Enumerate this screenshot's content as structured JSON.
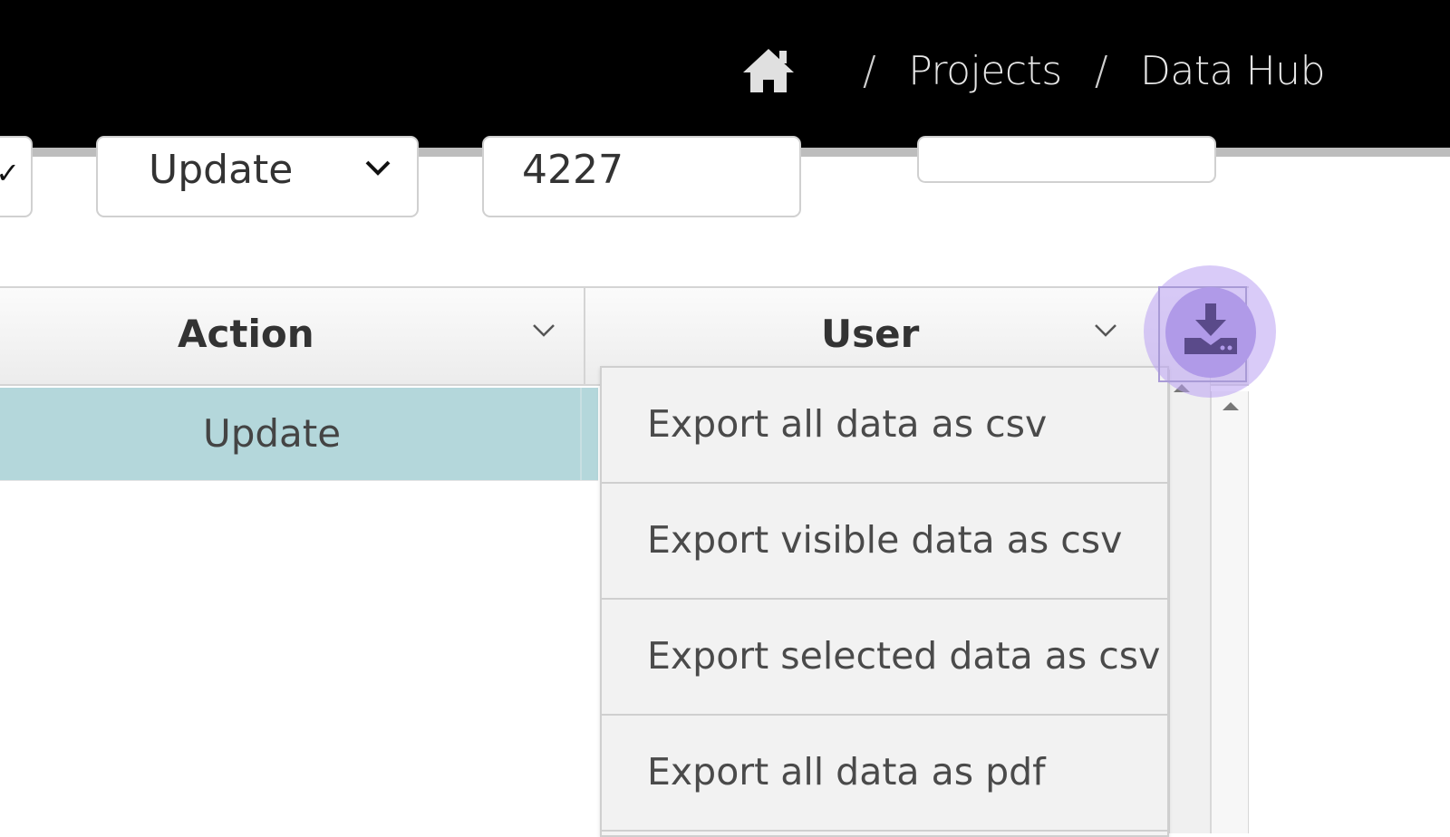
{
  "header": {
    "breadcrumb": {
      "home_icon": "home-icon",
      "separator": "/",
      "items": [
        "Projects",
        "Data Hub"
      ]
    }
  },
  "filters": {
    "action_select": {
      "value": "Update"
    },
    "id_input": {
      "value": "4227"
    }
  },
  "grid": {
    "columns": [
      {
        "label": "Action"
      },
      {
        "label": "User"
      }
    ],
    "rows": [
      {
        "action": "Update"
      }
    ]
  },
  "export_button": {
    "icon": "download-icon"
  },
  "export_menu": {
    "items": [
      {
        "label": "Export all data as csv"
      },
      {
        "label": "Export visible data as csv"
      },
      {
        "label": "Export selected data as csv"
      },
      {
        "label": "Export all data as pdf"
      }
    ]
  },
  "colors": {
    "header_bg": "#000000",
    "selected_row": "#b4d7db",
    "export_highlight": "#b09ae8"
  }
}
